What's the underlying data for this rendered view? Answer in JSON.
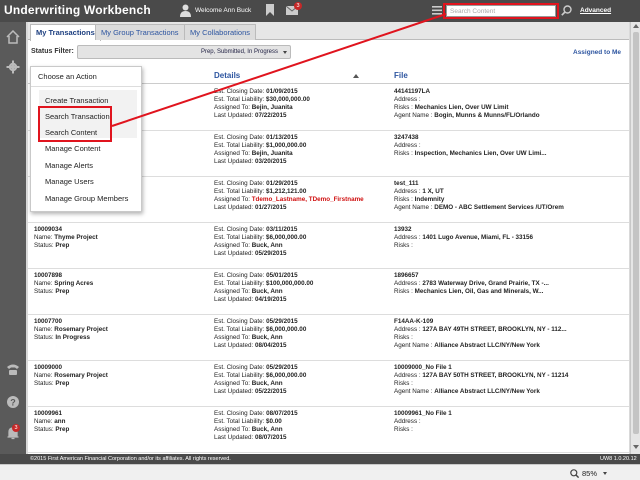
{
  "header": {
    "app_title": "Underwriting Workbench",
    "welcome": "Welcome Ann Buck",
    "mail_count": "3",
    "search_placeholder": "Search Content",
    "advanced": "Advanced"
  },
  "tabs": [
    {
      "label": "My Transactions",
      "active": true
    },
    {
      "label": "My Group Transactions",
      "active": false
    },
    {
      "label": "My Collaborations",
      "active": false
    }
  ],
  "filter": {
    "label": "Status Filter:",
    "value": "Prep, Submitted, In Progress",
    "assigned_to_me": "Assigned to Me"
  },
  "columns": {
    "details": "Details",
    "file": "File"
  },
  "action_menu": {
    "title": "Choose an Action",
    "items": [
      "Create Transaction",
      "Search Transaction",
      "Search Content",
      "Manage Content",
      "Manage Alerts",
      "Manage Users",
      "Manage Group Members"
    ]
  },
  "rows": [
    {
      "c1": [
        "",
        "",
        ""
      ],
      "c2": [
        [
          "Est. Closing Date: ",
          "01/09/2015"
        ],
        [
          "Est. Total Liability: ",
          "$30,000,000.00"
        ],
        [
          "Assigned To: ",
          "Bejin, Juanita"
        ],
        [
          "Last Updated: ",
          "07/22/2015"
        ]
      ],
      "c3": [
        [
          "",
          "44141197LA"
        ],
        [
          "Address : ",
          ""
        ],
        [
          "Risks : ",
          "Mechanics Lien, Over UW Limit"
        ],
        [
          "Agent Name : ",
          "Bogin, Munns & Munns/FL/Orlando"
        ]
      ]
    },
    {
      "c1": [
        "",
        "",
        ""
      ],
      "c2": [
        [
          "Est. Closing Date: ",
          "01/13/2015"
        ],
        [
          "Est. Total Liability: ",
          "$1,000,000.00"
        ],
        [
          "Assigned To: ",
          "Bejin, Juanita"
        ],
        [
          "Last Updated: ",
          "03/20/2015"
        ]
      ],
      "c3": [
        [
          "",
          "3247438"
        ],
        [
          "Address : ",
          ""
        ],
        [
          "Risks : ",
          "Inspection, Mechanics Lien, Over UW Limi..."
        ],
        [
          "",
          ""
        ]
      ]
    },
    {
      "c1": [
        "",
        "",
        ""
      ],
      "c2": [
        [
          "Est. Closing Date: ",
          "01/29/2015"
        ],
        [
          "Est. Total Liability: ",
          "$1,212,121.00"
        ],
        [
          "Assigned To: ",
          "Tdemo_Lastname, TDemo_Firstname"
        ],
        [
          "Last Updated: ",
          "01/27/2015"
        ]
      ],
      "c3": [
        [
          "",
          "test_111"
        ],
        [
          "Address : ",
          "1 X, UT"
        ],
        [
          "Risks : ",
          "Indemnity"
        ],
        [
          "Agent Name : ",
          "DEMO - ABC Settlement Services /UT/Orem"
        ]
      ]
    },
    {
      "c1": [
        [
          "",
          "10009034"
        ],
        [
          "Name: ",
          "Thyme Project"
        ],
        [
          "Status: ",
          "Prep"
        ]
      ],
      "c2": [
        [
          "Est. Closing Date: ",
          "03/11/2015"
        ],
        [
          "Est. Total Liability: ",
          "$6,000,000.00"
        ],
        [
          "Assigned To: ",
          "Buck, Ann"
        ],
        [
          "Last Updated: ",
          "05/29/2015"
        ]
      ],
      "c3": [
        [
          "",
          "13932"
        ],
        [
          "Address : ",
          "1401 Lugo Avenue, Miami, FL - 33156"
        ],
        [
          "Risks : ",
          ""
        ],
        [
          "",
          ""
        ]
      ]
    },
    {
      "c1": [
        [
          "",
          "10007898"
        ],
        [
          "Name: ",
          "Spring Acres"
        ],
        [
          "Status: ",
          "Prep"
        ]
      ],
      "c2": [
        [
          "Est. Closing Date: ",
          "05/01/2015"
        ],
        [
          "Est. Total Liability: ",
          "$100,000,000.00"
        ],
        [
          "Assigned To: ",
          "Buck, Ann"
        ],
        [
          "Last Updated: ",
          "04/19/2015"
        ]
      ],
      "c3": [
        [
          "",
          "1896657"
        ],
        [
          "Address : ",
          "2783 Waterway Drive, Grand Prairie, TX -..."
        ],
        [
          "Risks : ",
          "Mechanics Lien, Oil, Gas and Minerals, W..."
        ],
        [
          "",
          ""
        ]
      ]
    },
    {
      "c1": [
        [
          "",
          "10007700"
        ],
        [
          "Name: ",
          "Rosemary Project"
        ],
        [
          "Status: ",
          "In Progress"
        ]
      ],
      "c2": [
        [
          "Est. Closing Date: ",
          "05/29/2015"
        ],
        [
          "Est. Total Liability: ",
          "$6,000,000.00"
        ],
        [
          "Assigned To: ",
          "Buck, Ann"
        ],
        [
          "Last Updated: ",
          "08/04/2015"
        ]
      ],
      "c3": [
        [
          "",
          "F14AA-K-109"
        ],
        [
          "Address : ",
          "127A BAY 49TH STREET, BROOKLYN, NY - 112..."
        ],
        [
          "Risks : ",
          ""
        ],
        [
          "Agent Name : ",
          "Alliance Abstract LLC/NY/New York"
        ]
      ]
    },
    {
      "c1": [
        [
          "",
          "10009000"
        ],
        [
          "Name: ",
          "Rosemary Project"
        ],
        [
          "Status: ",
          "Prep"
        ]
      ],
      "c2": [
        [
          "Est. Closing Date: ",
          "05/29/2015"
        ],
        [
          "Est. Total Liability: ",
          "$6,000,000.00"
        ],
        [
          "Assigned To: ",
          "Buck, Ann"
        ],
        [
          "Last Updated: ",
          "05/22/2015"
        ]
      ],
      "c3": [
        [
          "",
          "10009000_No File 1"
        ],
        [
          "Address : ",
          "127A BAY 50TH STREET, BROOKLYN, NY - 11214"
        ],
        [
          "Risks : ",
          ""
        ],
        [
          "Agent Name : ",
          "Alliance Abstract LLC/NY/New York"
        ]
      ]
    },
    {
      "c1": [
        [
          "",
          "10009961"
        ],
        [
          "Name: ",
          "ann"
        ],
        [
          "Status: ",
          "Prep"
        ]
      ],
      "c2": [
        [
          "Est. Closing Date: ",
          "08/07/2015"
        ],
        [
          "Est. Total Liability: ",
          "$0.00"
        ],
        [
          "Assigned To: ",
          "Buck, Ann"
        ],
        [
          "Last Updated: ",
          "08/07/2015"
        ]
      ],
      "c3": [
        [
          "",
          "10009961_No File 1"
        ],
        [
          "Address : ",
          ""
        ],
        [
          "Risks : ",
          ""
        ],
        [
          "",
          ""
        ]
      ]
    }
  ],
  "footer": {
    "copyright": "©2015 First American Financial Corporation and/or its affiliates. All rights reserved.",
    "version": "UW8 1.0.20.12",
    "notification_count": "3"
  },
  "statusbar": {
    "zoom": "85%"
  },
  "colors": {
    "accent_red": "#e0141e",
    "link_blue": "#2d55a0",
    "header_bg": "#4a4a4a"
  }
}
